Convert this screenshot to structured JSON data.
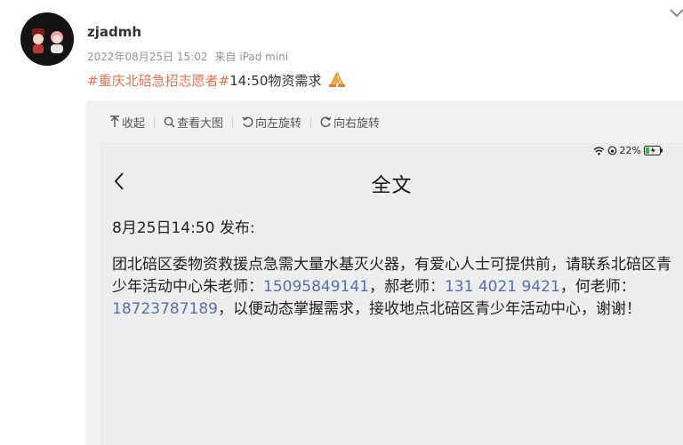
{
  "post": {
    "username": "zjadmh",
    "date": "2022年08月25日 15:02",
    "source_prefix": "来自",
    "source_device": "iPad mini",
    "topic": "#重庆北碚急招志愿者#",
    "text": "14:50物资需求",
    "emoji": "pray-hands-emoji"
  },
  "toolbar": {
    "collapse": "收起",
    "view_large": "查看大图",
    "rotate_left": "向左旋转",
    "rotate_right": "向右旋转"
  },
  "screenshot": {
    "status": {
      "battery_percent": "22%"
    },
    "title": "全文",
    "published": "8月25日14:50 发布:",
    "body": {
      "part1": "团北碚区委物资救援点急需大量水基灭火器，有爱心人士可提供前，请联系北碚区青少年活动中心朱老师：",
      "phone1": "15095849141",
      "part2": "，郝老师：",
      "phone2": "131 4021 9421",
      "part3": "，何老师：",
      "phone3": "18723787189",
      "part4": "，以便动态掌握需求，接收地点北碚区青少年活动中心，谢谢！"
    }
  },
  "colors": {
    "topic": "#eb7350",
    "phone": "#5b6fa8",
    "meta": "#939393"
  }
}
